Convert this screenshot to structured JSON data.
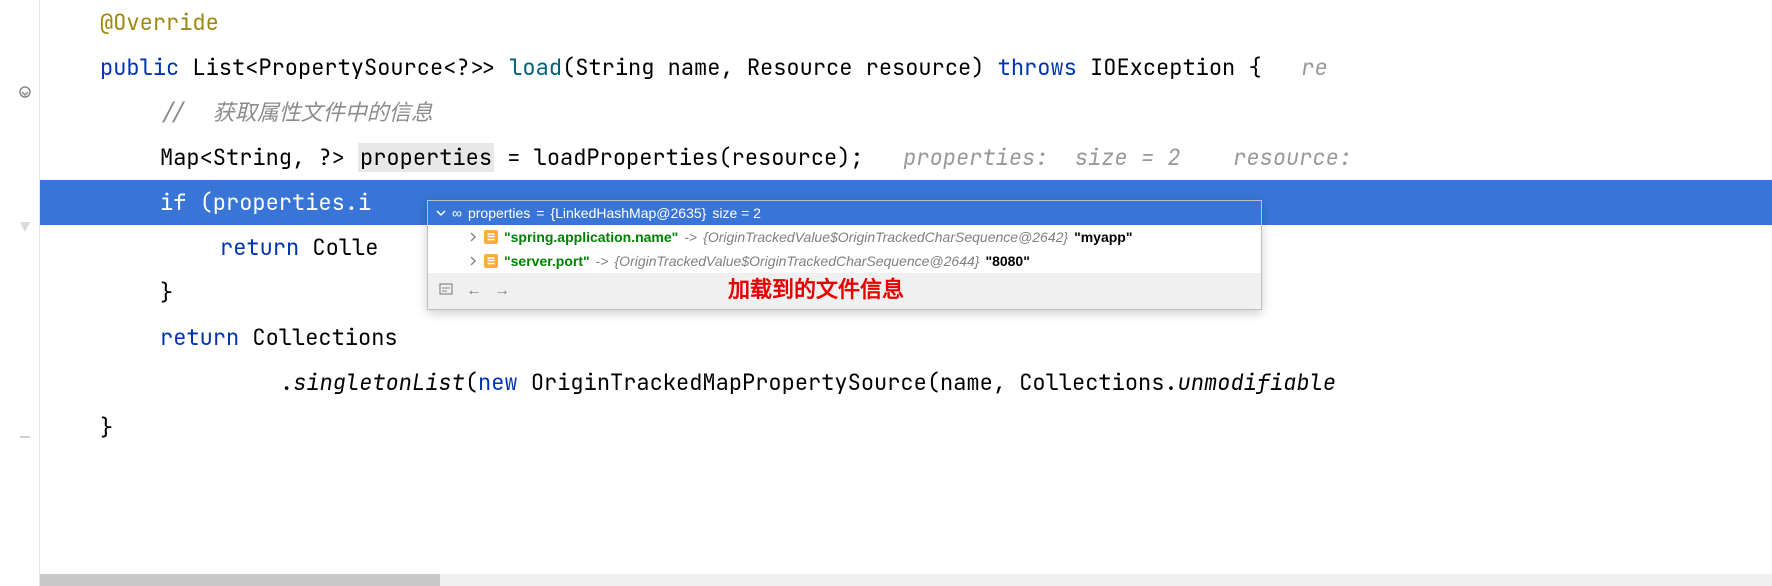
{
  "code": {
    "l1_annotation": "@Override",
    "l2_kw1": "public",
    "l2_type1": " List<PropertySource<?>> ",
    "l2_method": "load",
    "l2_params": "(String name, Resource resource) ",
    "l2_kw2": "throws",
    "l2_tail": " IOException {   ",
    "l2_hint": "re",
    "l3_comment": "//  获取属性文件中的信息",
    "l4_pre": "Map<String, ?> ",
    "l4_var": "properties",
    "l4_mid": " = loadProperties(resource);   ",
    "l4_hint": "properties:  size = 2    resource:",
    "l5_kw": "if",
    "l5_rest": " (properties.i",
    "l6_kw": "return",
    "l6_rest": " Colle",
    "l7": "}",
    "l8_kw": "return",
    "l8_rest": " Collections",
    "l9_pre": ".",
    "l9_method": "singletonList",
    "l9_paren": "(",
    "l9_kw": "new",
    "l9_mid": " OriginTrackedMapPropertySource(name, Collections.",
    "l9_method2": "unmodifiable",
    "l10": "}"
  },
  "debug": {
    "header_var": "properties",
    "header_eq": " = ",
    "header_type": "{LinkedHashMap@2635}",
    "header_size": "  size = 2",
    "row1_key": "\"spring.application.name\"",
    "row1_arrow": " -> ",
    "row1_ref": "{OriginTrackedValue$OriginTrackedCharSequence@2642}",
    "row1_val": " \"myapp\"",
    "row2_key": "\"server.port\"",
    "row2_arrow": " -> ",
    "row2_ref": "{OriginTrackedValue$OriginTrackedCharSequence@2644}",
    "row2_val": " \"8080\"",
    "annotation": "加载到的文件信息"
  }
}
